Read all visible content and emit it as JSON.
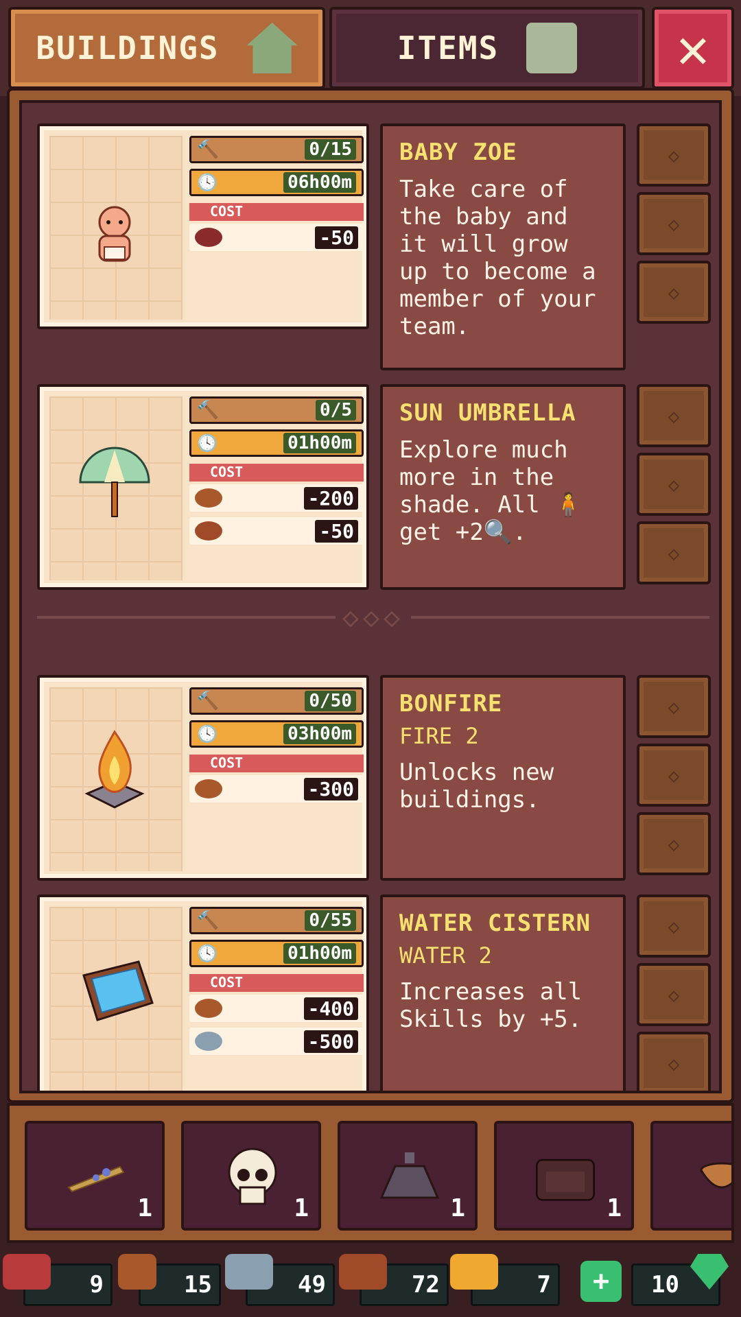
{
  "tabs": {
    "buildings_label": "BUILDINGS",
    "items_label": "ITEMS",
    "close_label": "✕"
  },
  "cards": [
    {
      "title": "BABY ZOE",
      "subtitle": "",
      "description": "Take care of the baby and it will grow up to become a member of your team.",
      "progress": "0/15",
      "time": "06h00m",
      "cost_label": "COST",
      "costs": [
        {
          "icon": "meat-icon",
          "value": "-50"
        }
      ]
    },
    {
      "title": "SUN UMBRELLA",
      "subtitle": "",
      "description": "Explore much more in the shade. All 🧍 get +2🔍.",
      "progress": "0/5",
      "time": "01h00m",
      "cost_label": "COST",
      "costs": [
        {
          "icon": "log-icon",
          "value": "-200"
        },
        {
          "icon": "rope-icon",
          "value": "-50"
        }
      ]
    },
    {
      "title": "BONFIRE",
      "subtitle": "FIRE 2",
      "description": "Unlocks new buildings.",
      "progress": "0/50",
      "time": "03h00m",
      "cost_label": "COST",
      "costs": [
        {
          "icon": "log-icon",
          "value": "-300"
        }
      ]
    },
    {
      "title": "WATER CISTERN",
      "subtitle": "WATER 2",
      "description": "Increases all Skills by +5.",
      "progress": "0/55",
      "time": "01h00m",
      "cost_label": "COST",
      "costs": [
        {
          "icon": "log-icon",
          "value": "-400"
        },
        {
          "icon": "stone-icon",
          "value": "-500"
        }
      ]
    }
  ],
  "inventory": [
    {
      "icon": "herb-bundle-icon",
      "count": "1"
    },
    {
      "icon": "skull-icon",
      "count": "1"
    },
    {
      "icon": "bottle-icon",
      "count": "1"
    },
    {
      "icon": "armchair-icon",
      "count": "1"
    },
    {
      "icon": "bowl-icon",
      "count": ""
    }
  ],
  "resources": [
    {
      "icon": "meat-icon",
      "value": "9",
      "color": "#b83a3a"
    },
    {
      "icon": "log-icon",
      "value": "15",
      "color": "#a8582a"
    },
    {
      "icon": "stone-icon",
      "value": "49",
      "color": "#8aa0b0"
    },
    {
      "icon": "rope-icon",
      "value": "72",
      "color": "#a04a2a"
    },
    {
      "icon": "gold-icon",
      "value": "7",
      "color": "#f0a830"
    },
    {
      "icon": "gem-icon",
      "value": "10",
      "color": "#38c070"
    }
  ],
  "colors": {
    "accent_tab": "#b36b3c",
    "close": "#c7344a",
    "title_yellow": "#f6e070"
  }
}
